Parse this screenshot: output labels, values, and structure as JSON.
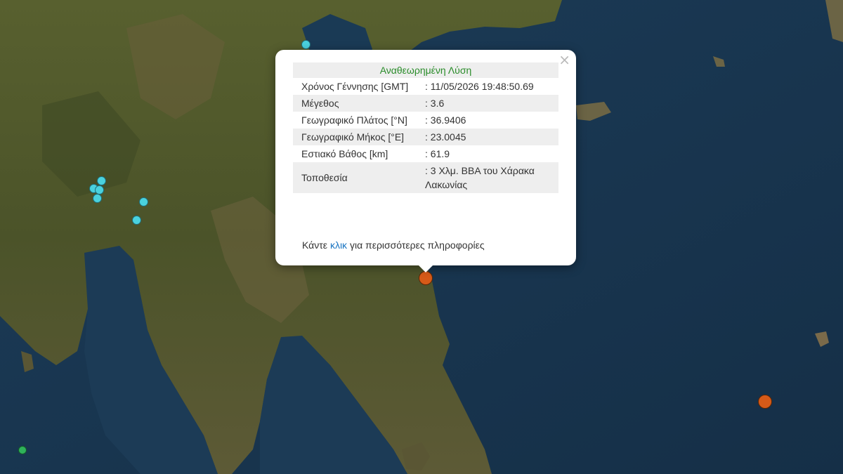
{
  "popup": {
    "title": "Αναθεωρημένη Λύση",
    "close_symbol": "×",
    "rows": [
      {
        "label": "Χρόνος Γέννησης [GMT]",
        "value": ": 11/05/2026 19:48:50.69"
      },
      {
        "label": "Μέγεθος",
        "value": ": 3.6"
      },
      {
        "label": "Γεωγραφικό Πλάτος [°N]",
        "value": ": 36.9406"
      },
      {
        "label": "Γεωγραφικό Μήκος [°E]",
        "value": ": 23.0045"
      },
      {
        "label": "Εστιακό Βάθος [km]",
        "value": ": 61.9"
      },
      {
        "label": "Τοποθεσία",
        "value": ": 3 Χλμ. ΒΒΑ του Χάρακα Λακωνίας"
      }
    ],
    "footer_prefix": "Κάντε",
    "footer_link": "κλικ",
    "footer_suffix": "για περισσότερες πληροφορίες"
  },
  "colors": {
    "sea": "#1d3a55",
    "land": "#4a5a2c",
    "marker_recent_small": "#4ad2de",
    "marker_selected": "#d65a18",
    "marker_green": "#2fb25a",
    "title_green": "#2a8c2a",
    "link_blue": "#1a75c2"
  },
  "markers": [
    {
      "name": "quake-marker-cyan"
    },
    {
      "name": "quake-marker-cyan"
    },
    {
      "name": "quake-marker-cyan"
    },
    {
      "name": "quake-marker-cyan"
    },
    {
      "name": "quake-marker-cyan"
    },
    {
      "name": "quake-marker-cyan"
    },
    {
      "name": "quake-marker-cyan"
    },
    {
      "name": "quake-marker-selected"
    },
    {
      "name": "quake-marker-orange"
    },
    {
      "name": "quake-marker-green"
    }
  ]
}
